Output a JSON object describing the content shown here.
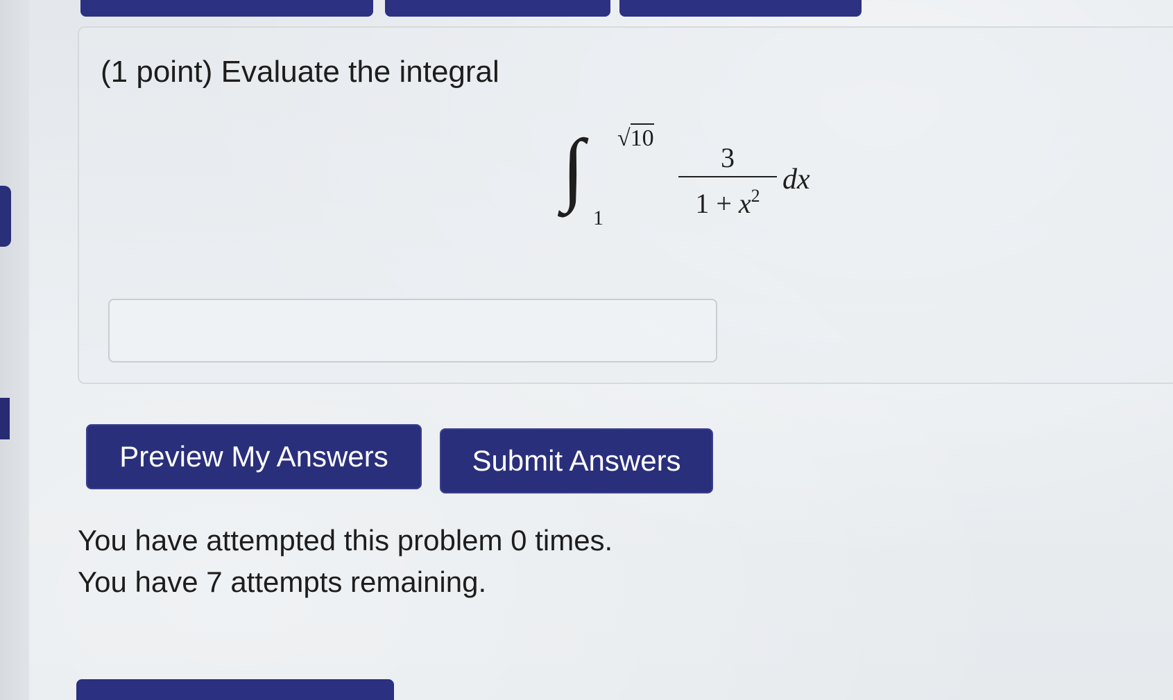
{
  "problem": {
    "prompt": "(1 point) Evaluate the integral",
    "integral": {
      "symbol": "∫",
      "upper_radical": "√",
      "upper_radicand": "10",
      "lower_limit": "1",
      "numerator": "3",
      "denominator_prefix": "1 + ",
      "denominator_var": "x",
      "denominator_exp": "2",
      "differential": "dx"
    },
    "answer": {
      "value": "",
      "placeholder": ""
    }
  },
  "actions": {
    "preview_label": "Preview My Answers",
    "submit_label": "Submit Answers"
  },
  "status": {
    "attempted": "You have attempted this problem 0 times.",
    "remaining": "You have 7 attempts remaining."
  },
  "colors": {
    "button_bg": "#2a2f7c",
    "button_text": "#ffffff",
    "page_bg": "#e9ecef"
  }
}
